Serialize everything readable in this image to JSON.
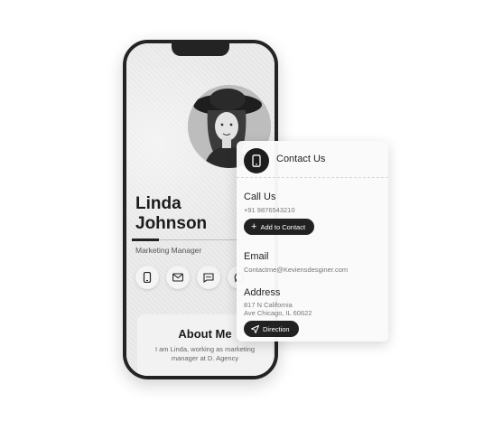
{
  "profile": {
    "name_first": "Linda",
    "name_last": "Johnson",
    "role": "Marketing Manager",
    "about_title": "About Me",
    "about_text": "I am Linda, working as marketing manager at D. Agency"
  },
  "contact_card": {
    "title": "Contact Us",
    "call_title": "Call Us",
    "phone": "+91 9876543210",
    "add_button": "Add to Contact",
    "email_title": "Email",
    "email": "Contactme@Keviensdesginer.com",
    "address_title": "Address",
    "address_line1": "817 N California",
    "address_line2": "Ave Chicago, IL 60622",
    "direction_button": "Direction"
  },
  "icons": [
    "phone-icon",
    "mail-icon",
    "message-icon",
    "whatsapp-icon"
  ],
  "colors": {
    "dark": "#222222",
    "muted": "#777777",
    "background": "#ffffff"
  }
}
